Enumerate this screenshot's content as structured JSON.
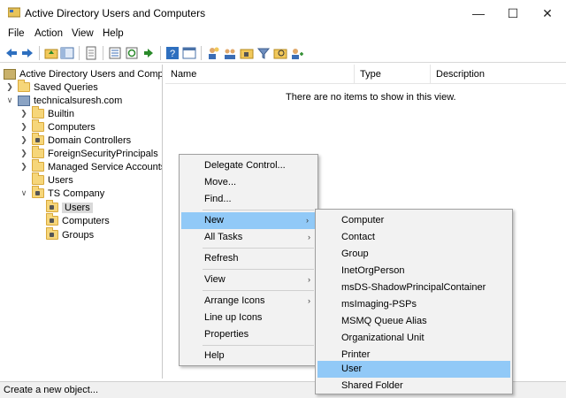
{
  "window": {
    "title": "Active Directory Users and Computers",
    "minimize": "—",
    "maximize": "☐",
    "close": "✕"
  },
  "menu": [
    "File",
    "Action",
    "View",
    "Help"
  ],
  "toolbar_icons": [
    "back-arrow-icon",
    "forward-arrow-icon",
    "up-folder-icon",
    "show-hide-tree-icon",
    "properties-icon",
    "export-list-icon",
    "refresh-icon",
    "help-icon",
    "console-icon",
    "new-user-icon",
    "new-group-icon",
    "new-ou-icon",
    "filter-icon",
    "find-icon",
    "add-to-group-icon"
  ],
  "tree": {
    "root": "Active Directory Users and Computers",
    "items": [
      {
        "label": "Saved Queries"
      },
      {
        "label": "technicalsuresh.com"
      },
      {
        "label": "Builtin"
      },
      {
        "label": "Computers"
      },
      {
        "label": "Domain Controllers"
      },
      {
        "label": "ForeignSecurityPrincipals"
      },
      {
        "label": "Managed Service Accounts"
      },
      {
        "label": "Users"
      },
      {
        "label": "TS Company"
      },
      {
        "label": "Users"
      },
      {
        "label": "Computers"
      },
      {
        "label": "Groups"
      }
    ]
  },
  "list": {
    "columns": [
      "Name",
      "Type",
      "Description"
    ],
    "empty_message": "There are no items to show in this view."
  },
  "context_menu": {
    "items": [
      "Delegate Control...",
      "Move...",
      "Find...",
      "New",
      "All Tasks",
      "Refresh",
      "View",
      "Arrange Icons",
      "Line up Icons",
      "Properties",
      "Help"
    ],
    "arrow": "›"
  },
  "submenu": {
    "items": [
      "Computer",
      "Contact",
      "Group",
      "InetOrgPerson",
      "msDS-ShadowPrincipalContainer",
      "msImaging-PSPs",
      "MSMQ Queue Alias",
      "Organizational Unit",
      "Printer",
      "User",
      "Shared Folder"
    ]
  },
  "status": "Create a new object...",
  "colors": {
    "highlight": "#91c9f7",
    "menu_bg": "#f2f2f2"
  }
}
